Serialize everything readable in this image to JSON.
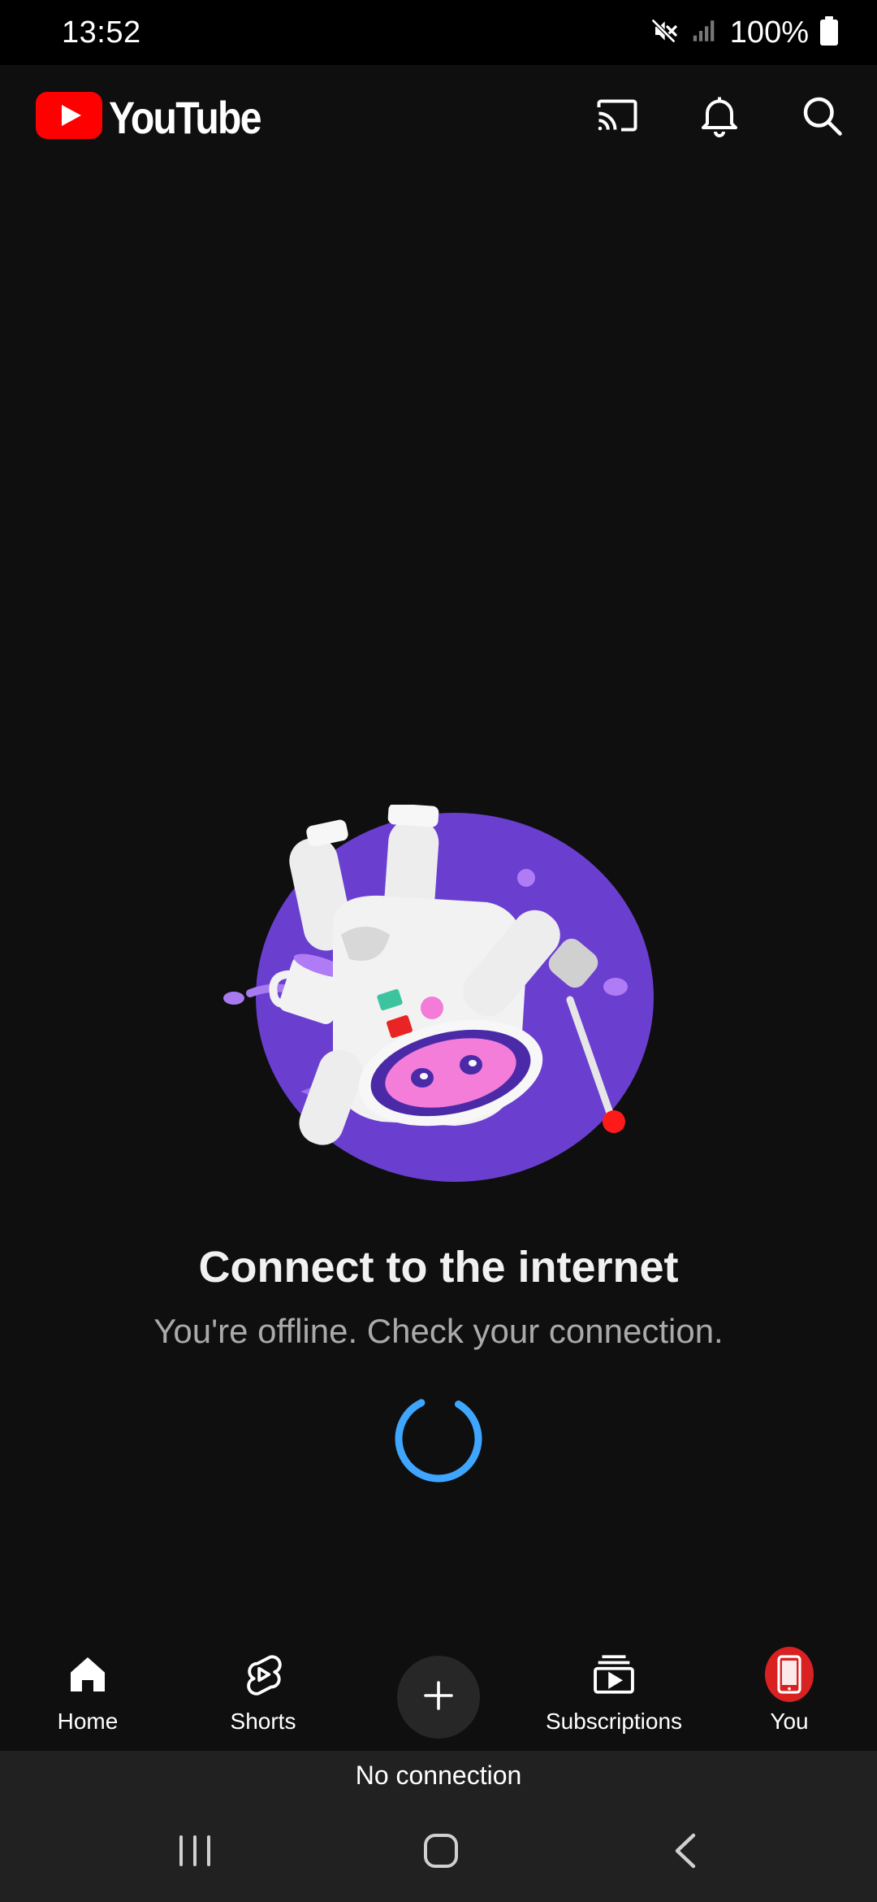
{
  "status_bar": {
    "time": "13:52",
    "battery": "100%",
    "icons": [
      "mute-icon",
      "signal-icon",
      "battery-icon"
    ]
  },
  "header": {
    "logo_text": "YouTube",
    "actions": [
      "cast-icon",
      "notifications-bell-icon",
      "search-icon"
    ]
  },
  "offline": {
    "title": "Connect to the internet",
    "message": "You're offline. Check your connection."
  },
  "nav": {
    "home": "Home",
    "shorts": "Shorts",
    "create": "create-plus-icon",
    "subscriptions": "Subscriptions",
    "you": "You"
  },
  "connection_banner": "No connection",
  "colors": {
    "background": "#0f0f0f",
    "brand_red": "#ff0000",
    "spinner_blue": "#3ea6ff",
    "illustration_purple": "#6a3fd0"
  }
}
